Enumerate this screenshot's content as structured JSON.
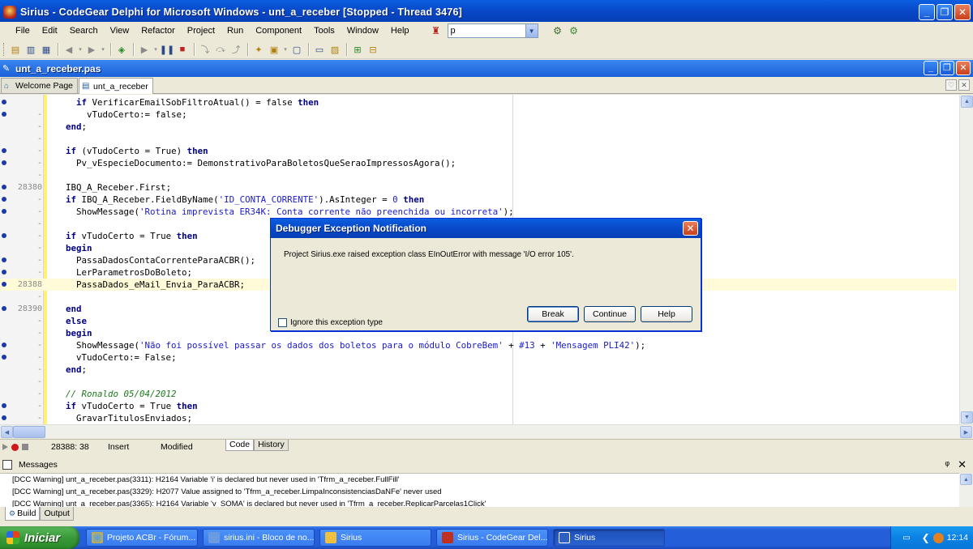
{
  "window": {
    "title": "Sirius - CodeGear Delphi for Microsoft Windows - unt_a_receber [Stopped - Thread 3476]",
    "minimize": "_",
    "maximize": "❐",
    "close": "✕"
  },
  "menu": {
    "items": [
      "File",
      "Edit",
      "Search",
      "View",
      "Refactor",
      "Project",
      "Run",
      "Component",
      "Tools",
      "Window",
      "Help"
    ],
    "combo_value": "p"
  },
  "child_window": {
    "title": "unt_a_receber.pas"
  },
  "tabs": [
    {
      "label": "Welcome Page"
    },
    {
      "label": "unt_a_receber",
      "active": true
    }
  ],
  "editor": {
    "lines": [
      {
        "num": "",
        "bp": true,
        "text": "    if VerificarEmailSobFiltroAtual() = false then"
      },
      {
        "num": "-",
        "bp": true,
        "text": "      vTudoCerto:= false;"
      },
      {
        "num": "-",
        "bp": false,
        "text": "  end;"
      },
      {
        "num": "-",
        "bp": false,
        "text": ""
      },
      {
        "num": "-",
        "bp": true,
        "text": "  if (vTudoCerto = True) then"
      },
      {
        "num": "-",
        "bp": true,
        "text": "    Pv_vEspecieDocumento:= DemonstrativoParaBoletosQueSeraoImpressosAgora();"
      },
      {
        "num": "-",
        "bp": false,
        "text": ""
      },
      {
        "num": "28380",
        "bp": true,
        "text": "  IBQ_A_Receber.First;"
      },
      {
        "num": "-",
        "bp": true,
        "text": "  if IBQ_A_Receber.FieldByName('ID_CONTA_CORRENTE').AsInteger = 0 then"
      },
      {
        "num": "-",
        "bp": true,
        "text": "    ShowMessage('Rotina imprevista ER34K: Conta corrente não preenchida ou incorreta');"
      },
      {
        "num": "-",
        "bp": false,
        "text": ""
      },
      {
        "num": "-",
        "bp": true,
        "text": "  if vTudoCerto = True then"
      },
      {
        "num": "-",
        "bp": false,
        "text": "  begin"
      },
      {
        "num": "-",
        "bp": true,
        "text": "    PassaDadosContaCorrenteParaACBR();"
      },
      {
        "num": "-",
        "bp": true,
        "text": "    LerParametrosDoBoleto;"
      },
      {
        "num": "28388",
        "bp": true,
        "text": "    PassaDados_eMail_Envia_ParaACBR;",
        "highlight": true
      },
      {
        "num": "-",
        "bp": false,
        "text": ""
      },
      {
        "num": "28390",
        "bp": true,
        "text": "  end"
      },
      {
        "num": "-",
        "bp": false,
        "text": "  else"
      },
      {
        "num": "-",
        "bp": false,
        "text": "  begin"
      },
      {
        "num": "-",
        "bp": true,
        "text": "    ShowMessage('Não foi possível passar os dados dos boletos para o módulo CobreBem' + #13 + 'Mensagem PLI42');"
      },
      {
        "num": "-",
        "bp": true,
        "text": "    vTudoCerto:= False;"
      },
      {
        "num": "-",
        "bp": false,
        "text": "  end;"
      },
      {
        "num": "-",
        "bp": false,
        "text": ""
      },
      {
        "num": "-",
        "bp": false,
        "text": "  // Ronaldo 05/04/2012"
      },
      {
        "num": "-",
        "bp": true,
        "text": "  if vTudoCerto = True then"
      },
      {
        "num": "-",
        "bp": true,
        "text": "    GravarTitulosEnviados;"
      }
    ]
  },
  "statusbar": {
    "position": "28388: 38",
    "mode": "Insert",
    "state": "Modified",
    "tabs": [
      "Code",
      "History"
    ]
  },
  "messages": {
    "title": "Messages",
    "pin": "ᵠ",
    "close": "✕",
    "lines": [
      "[DCC Warning] unt_a_receber.pas(3311): H2164 Variable 'i' is declared but never used in 'Tfrm_a_receber.FullFill'",
      "[DCC Warning] unt_a_receber.pas(3329): H2077 Value assigned to 'Tfrm_a_receber.LimpaInconsistenciasDaNFe' never used",
      "[DCC Warning] unt_a_receber.pas(3365): H2164 Variable 'v_SOMA' is declared but never used in 'Tfrm_a_receber.ReplicarParcelas1Click'"
    ],
    "tabs": [
      "Build",
      "Output"
    ]
  },
  "dialog": {
    "title": "Debugger Exception Notification",
    "close": "✕",
    "message": "Project Sirius.exe raised exception class EInOutError with message 'I/O error 105'.",
    "checkbox_label": "Ignore this exception type",
    "buttons": {
      "break": "Break",
      "continue": "Continue",
      "help": "Help"
    }
  },
  "taskbar": {
    "start": "Iniciar",
    "tasks": [
      {
        "label": "Projeto ACBr - Fórum...",
        "icon_color": "#e8b020"
      },
      {
        "label": "sirius.ini - Bloco de no...",
        "icon_color": "#6a9ae0"
      },
      {
        "label": "Sirius",
        "icon_color": "#f0c040"
      },
      {
        "label": "Sirius - CodeGear Del...",
        "icon_color": "#c03020"
      },
      {
        "label": "Sirius",
        "icon_color": "#3060c0",
        "active": true
      }
    ],
    "clock": "12:14"
  }
}
